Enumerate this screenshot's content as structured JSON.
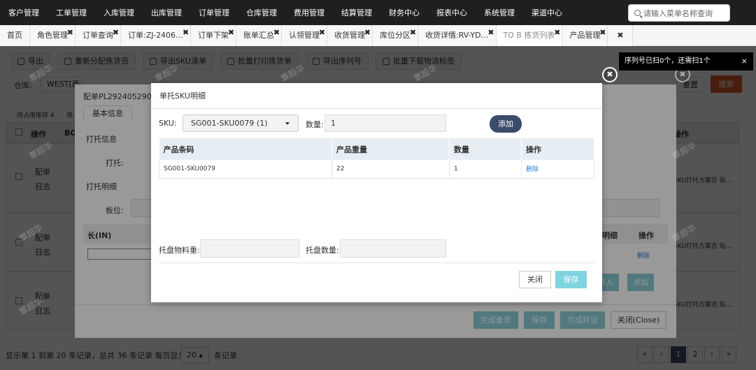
{
  "top_nav": [
    "客户管理",
    "工单管理",
    "入库管理",
    "出库管理",
    "订单管理",
    "仓库管理",
    "费用管理",
    "结算管理",
    "财务中心",
    "报表中心",
    "系统管理",
    "渠道中心"
  ],
  "search_placeholder": "请输入菜单名称查询",
  "tabs": [
    {
      "label": "首页",
      "closable": false
    },
    {
      "label": "角色管理",
      "closable": true
    },
    {
      "label": "订单查询",
      "closable": true
    },
    {
      "label": "订单:ZJ-2406…",
      "closable": true
    },
    {
      "label": "订单下架",
      "closable": true
    },
    {
      "label": "账单汇总",
      "closable": true
    },
    {
      "label": "认领管理",
      "closable": true
    },
    {
      "label": "收货管理",
      "closable": true
    },
    {
      "label": "库位分区",
      "closable": true
    },
    {
      "label": "收货详情:RV-YD…",
      "closable": true
    },
    {
      "label": "TO B 拣货列表",
      "closable": true,
      "active": true
    },
    {
      "label": "产品管理",
      "closable": true
    },
    {
      "label": "",
      "closable": true
    }
  ],
  "toolbar": [
    "导出",
    "重新分配拣货员",
    "导出SKU清单",
    "批量打印拣货单",
    "导出序列号",
    "批量下载物流标签"
  ],
  "toast": "序列号已扫0个，还需扫1个",
  "background": {
    "warehouse_label": "仓库:",
    "warehouse_value": "WEST[西…",
    "reset": "重置",
    "search_btn": "搜索",
    "sub_tabs": [
      "待占用库存 4",
      "待…"
    ],
    "col_op": "操作",
    "col_b": "BO",
    "row_links": [
      "配单",
      "日志"
    ],
    "right_col": "操作",
    "right_text": "SKU打托方案否 贴…",
    "right_del": "删除",
    "right_mingxi": "明细",
    "pagination_text": "显示第 1 到第 20 条记录，总共 36 条记录 每页显示",
    "page_size": "20",
    "page_size_suffix": "条记录",
    "pages": [
      "«",
      "‹",
      "1",
      "2",
      "›",
      "»"
    ]
  },
  "modal_a": {
    "title": "配单PL29240529001…",
    "tab_basic": "基本信息",
    "label_dt": "打托信息",
    "label_dt2": "打托:",
    "label_mx": "打托明细",
    "label_board": "板位:",
    "col_len": "长(IN)",
    "btn_in": "导入",
    "btn_add": "添加",
    "btn_finish": "完成备货",
    "btn_save": "保存",
    "btn_transfer": "完成转运",
    "btn_close": "关闭(Close)"
  },
  "modal": {
    "title": "单托SKU明细",
    "sku_label": "SKU:",
    "sku_value": "SG001-SKU0079 (1)",
    "qty_label": "数量:",
    "qty_value": "1",
    "add_btn": "添加",
    "headers": [
      "产品条码",
      "产品重量",
      "数量",
      "操作"
    ],
    "rows": [
      {
        "code": "SG001-SKU0079",
        "weight": "22",
        "qty": "1",
        "op": "删除"
      }
    ],
    "pallet_weight_label": "托盘物料重:",
    "pallet_qty_label": "托盘数量:",
    "close_btn": "关闭",
    "save_btn": "保存"
  },
  "watermark": "覃超华"
}
